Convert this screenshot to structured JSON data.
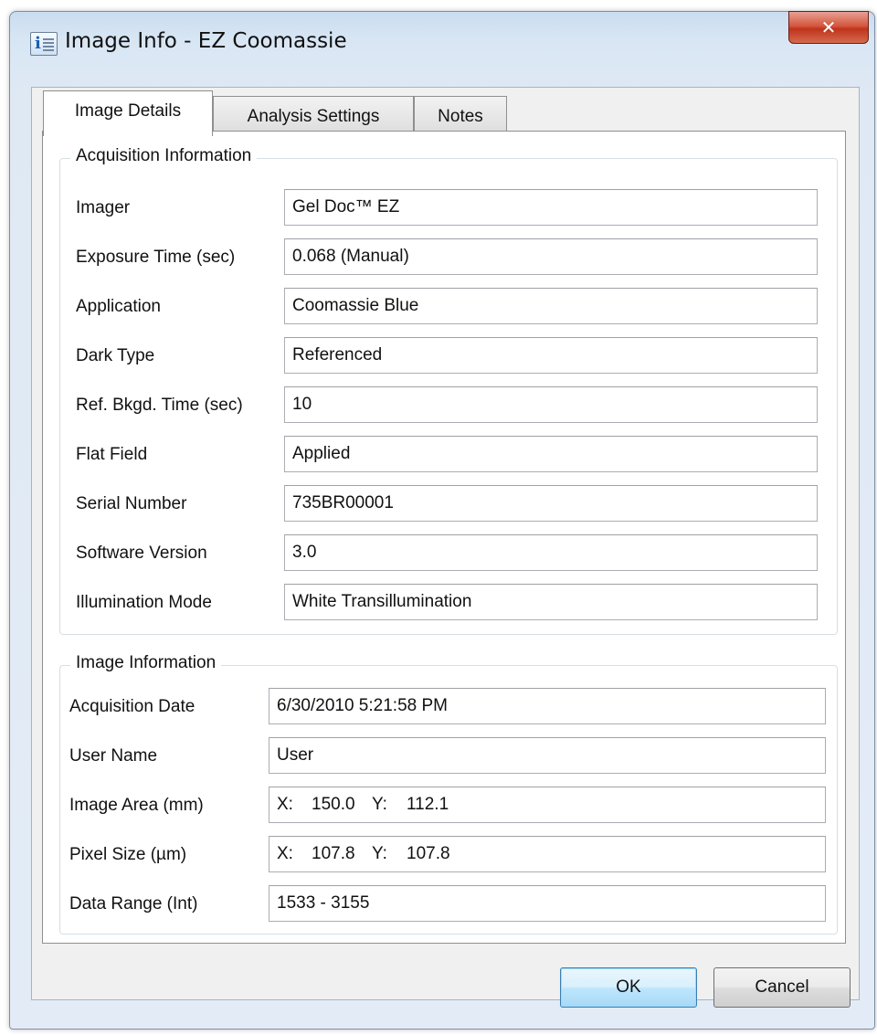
{
  "window": {
    "title": "Image Info - EZ Coomassie",
    "close_label": "✕"
  },
  "tabs": [
    {
      "label": "Image Details",
      "active": true
    },
    {
      "label": "Analysis Settings",
      "active": false
    },
    {
      "label": "Notes",
      "active": false
    }
  ],
  "acquisition": {
    "title": "Acquisition Information",
    "rows": [
      {
        "label": "Imager",
        "value": "Gel Doc™ EZ"
      },
      {
        "label": "Exposure Time (sec)",
        "value": "0.068 (Manual)"
      },
      {
        "label": "Application",
        "value": "Coomassie Blue"
      },
      {
        "label": "Dark Type",
        "value": "Referenced"
      },
      {
        "label": "Ref. Bkgd. Time (sec)",
        "value": "10"
      },
      {
        "label": "Flat Field",
        "value": "Applied"
      },
      {
        "label": "Serial Number",
        "value": "735BR00001"
      },
      {
        "label": "Software Version",
        "value": "3.0"
      },
      {
        "label": "Illumination Mode",
        "value": "White Transillumination"
      }
    ]
  },
  "image_info": {
    "title": "Image Information",
    "acquisition_date": {
      "label": "Acquisition Date",
      "value": "6/30/2010 5:21:58 PM"
    },
    "user_name": {
      "label": "User Name",
      "value": "User"
    },
    "image_area": {
      "label": "Image Area (mm)",
      "x_label": "X:",
      "x_value": "150.0",
      "y_label": "Y:",
      "y_value": "112.1"
    },
    "pixel_size": {
      "label": "Pixel Size (µm)",
      "x_label": "X:",
      "x_value": "107.8",
      "y_label": "Y:",
      "y_value": "107.8"
    },
    "data_range": {
      "label": "Data Range (Int)",
      "value": "1533 - 3155"
    }
  },
  "buttons": {
    "ok": "OK",
    "cancel": "Cancel"
  },
  "icons": {
    "window_icon": "info-icon",
    "close": "close-icon"
  }
}
